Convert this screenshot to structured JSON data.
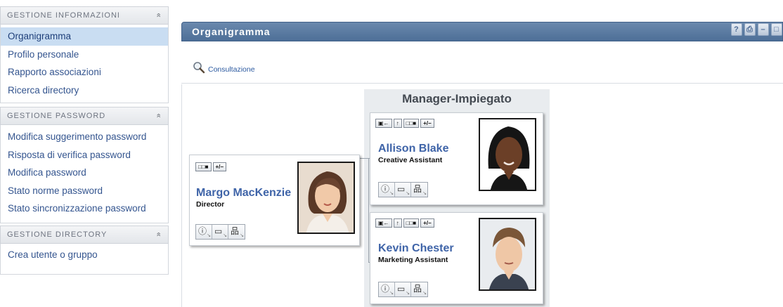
{
  "sidebar": {
    "sections": [
      {
        "title": "GESTIONE INFORMAZIONI",
        "items": [
          {
            "label": "Organigramma"
          },
          {
            "label": "Profilo personale"
          },
          {
            "label": "Rapporto associazioni"
          },
          {
            "label": "Ricerca directory"
          }
        ]
      },
      {
        "title": "GESTIONE PASSWORD",
        "items": [
          {
            "label": "Modifica suggerimento password"
          },
          {
            "label": "Risposta di verifica password"
          },
          {
            "label": "Modifica password"
          },
          {
            "label": "Stato norme password"
          },
          {
            "label": "Stato sincronizzazione password"
          }
        ]
      },
      {
        "title": "GESTIONE DIRECTORY",
        "items": [
          {
            "label": "Crea utente o gruppo"
          }
        ]
      }
    ],
    "collapse_glyph": "«",
    "active_item": "Organigramma"
  },
  "panel": {
    "title": "Organigramma",
    "buttons": [
      "?",
      "⎙",
      "–",
      "□"
    ]
  },
  "toolbar": {
    "lookup_label": "Consultazione"
  },
  "orgchart": {
    "group_title": "Manager-Impiegato",
    "manager": {
      "name": "Margo MacKenzie",
      "title": "Director",
      "mini_buttons": [
        "□□■",
        "+/−"
      ]
    },
    "reports": [
      {
        "name": "Allison Blake",
        "title": "Creative Assistant",
        "mini_buttons": [
          "▣←",
          "↑",
          "□□■",
          "+/−"
        ]
      },
      {
        "name": "Kevin Chester",
        "title": "Marketing Assistant",
        "mini_buttons": [
          "▣←",
          "↑",
          "□□■",
          "+/−"
        ]
      }
    ],
    "action_icons": [
      "info-icon",
      "email-icon",
      "orgchart-icon"
    ]
  },
  "colors": {
    "titlebar": "#5a7aa2",
    "active_item_bg": "#c9ddf2",
    "link": "#34558f",
    "person_name": "#3f64a8"
  }
}
